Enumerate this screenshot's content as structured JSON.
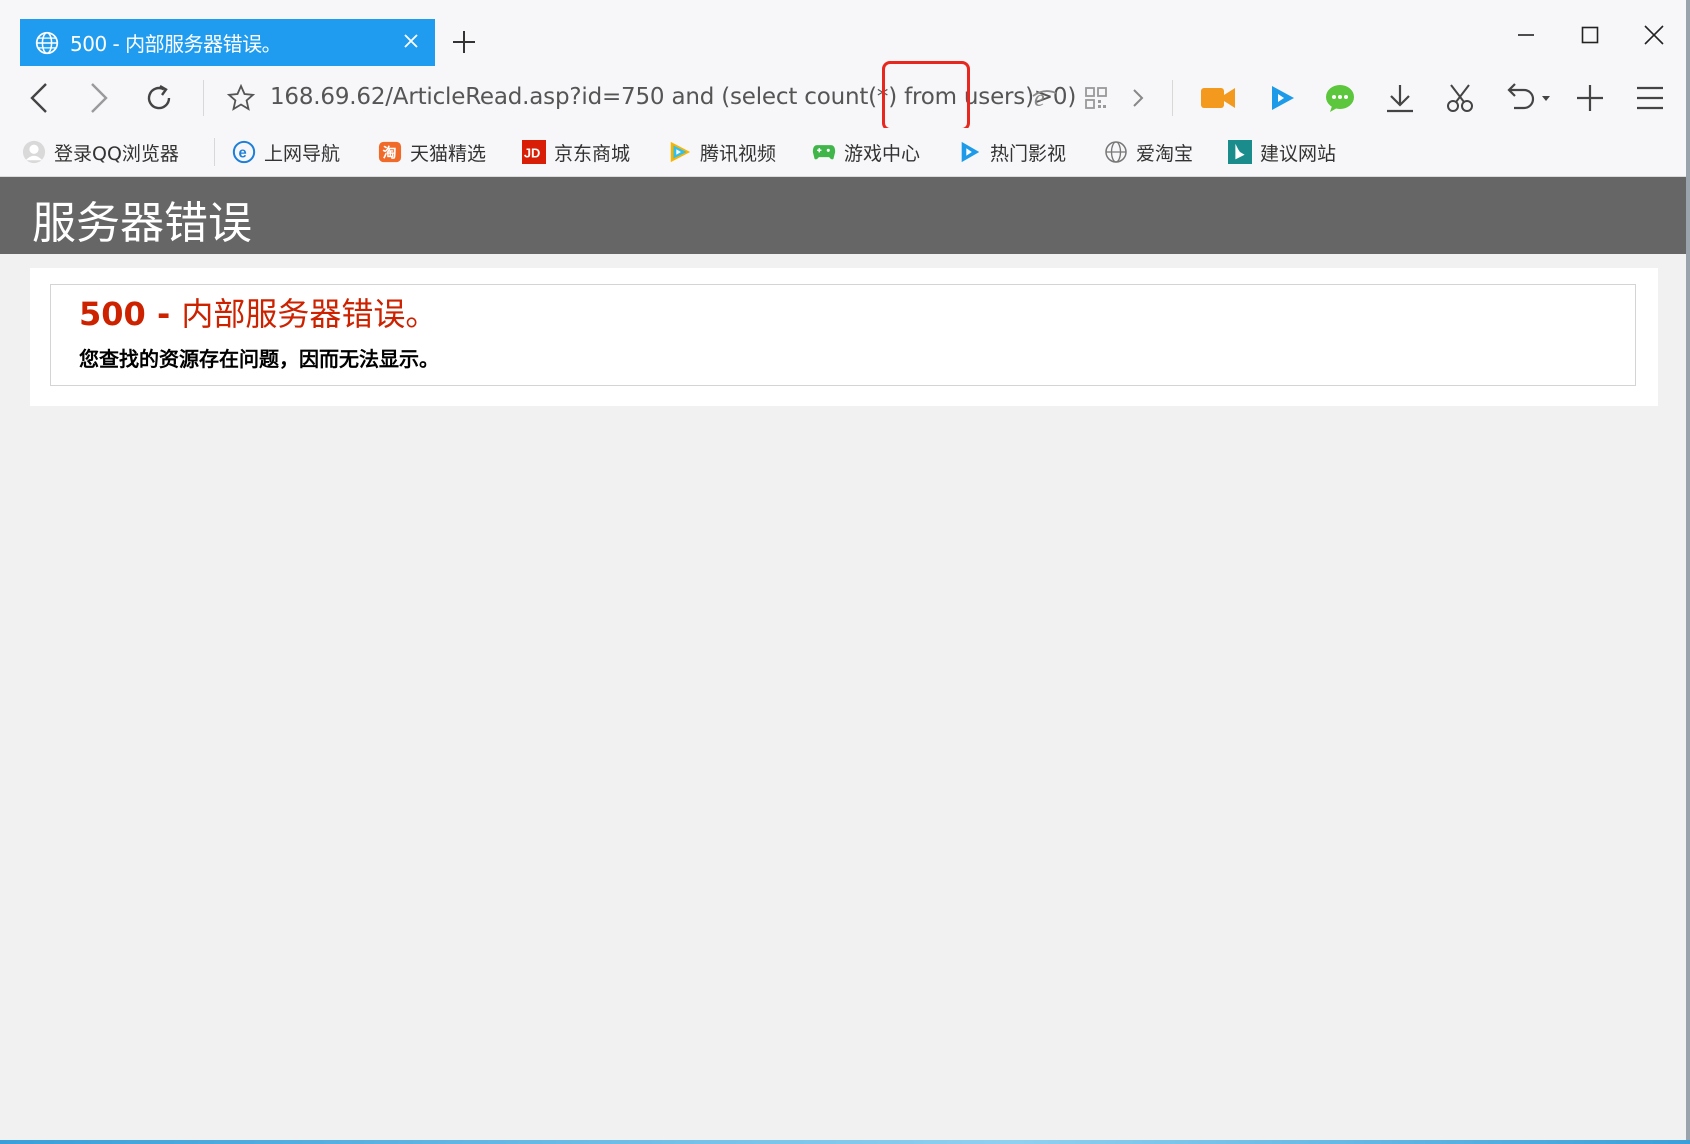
{
  "browser": {
    "tab": {
      "title": "500 - 内部服务器错误。"
    },
    "address_bar": {
      "url": "168.69.62/ArticleRead.asp?id=750 and (select count(*) from users)>0)"
    },
    "bookmarks": [
      {
        "label": "登录QQ浏览器",
        "icon": "user-avatar-icon"
      },
      {
        "label": "上网导航",
        "icon": "ie-icon"
      },
      {
        "label": "天猫精选",
        "icon": "tmall-icon"
      },
      {
        "label": "京东商城",
        "icon": "jd-icon"
      },
      {
        "label": "腾讯视频",
        "icon": "tencent-video-icon"
      },
      {
        "label": "游戏中心",
        "icon": "gamepad-icon"
      },
      {
        "label": "热门影视",
        "icon": "play-icon"
      },
      {
        "label": "爱淘宝",
        "icon": "globe-icon"
      },
      {
        "label": "建议网站",
        "icon": "bing-icon"
      }
    ]
  },
  "page": {
    "header": {
      "title": "服务器错误"
    },
    "error": {
      "code_prefix": "500 - ",
      "title": "内部服务器错误。",
      "description": "您查找的资源存在问题，因而无法显示。"
    }
  },
  "colors": {
    "tab_active": "#1f9cf0",
    "header_bg": "#666666",
    "error_red": "#cc2200",
    "highlight_box": "#e8281f"
  }
}
